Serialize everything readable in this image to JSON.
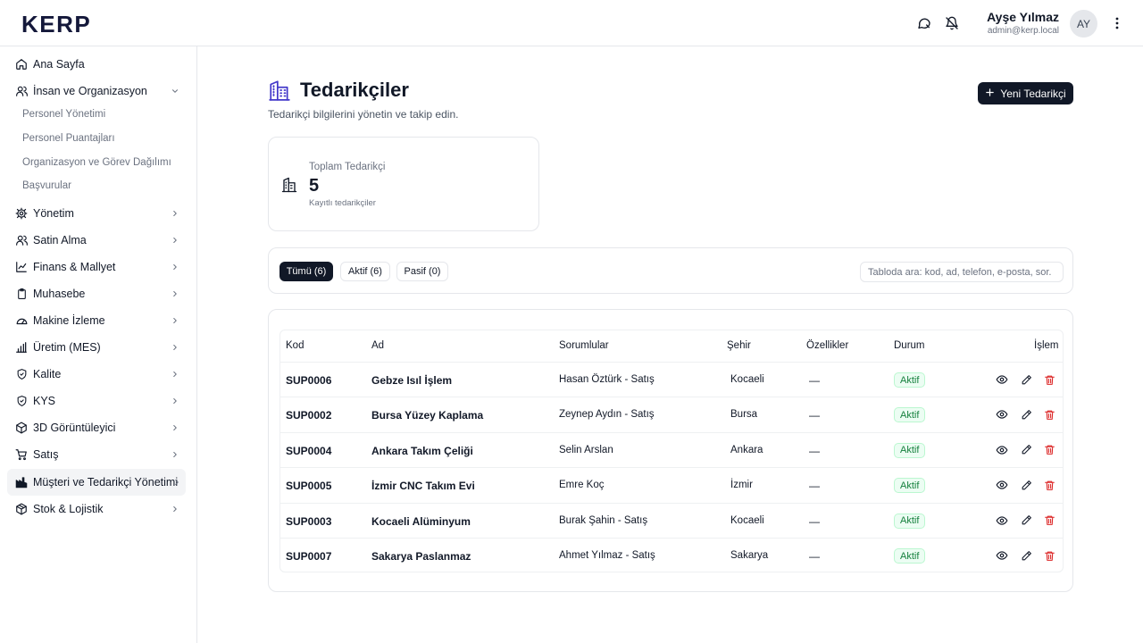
{
  "app": {
    "logo": "KERP"
  },
  "header": {
    "user_name": "Ayşe Yılmaz",
    "user_email": "admin@kerp.local",
    "avatar_initials": "AY"
  },
  "sidebar": {
    "items": [
      {
        "label": "Ana Sayfa",
        "icon": "home-icon"
      },
      {
        "label": "İnsan ve Organizasyon",
        "icon": "users-icon",
        "expanded": true
      },
      {
        "label": "Yönetim",
        "icon": "gear-icon"
      },
      {
        "label": "Satin Alma",
        "icon": "users-icon"
      },
      {
        "label": "Finans & Mallyet",
        "icon": "chart-line-icon"
      },
      {
        "label": "Muhasebe",
        "icon": "clipboard-icon"
      },
      {
        "label": "Makine İzleme",
        "icon": "gauge-icon"
      },
      {
        "label": "Üretim (MES)",
        "icon": "bar-chart-icon"
      },
      {
        "label": "Kalite",
        "icon": "shield-check-icon"
      },
      {
        "label": "KYS",
        "icon": "shield-check-icon"
      },
      {
        "label": "3D Görüntüleyici",
        "icon": "cube-icon"
      },
      {
        "label": "Satış",
        "icon": "cart-icon"
      },
      {
        "label": "Müşteri ve Tedarikçi Yönetimi",
        "icon": "factory-icon",
        "active": true
      },
      {
        "label": "Stok & Lojistik",
        "icon": "package-icon"
      }
    ],
    "sub_items": [
      "Personel Yönetimi",
      "Personel Puantajları",
      "Organizasyon ve Görev Dağılımı",
      "Başvurular"
    ]
  },
  "page": {
    "title": "Tedarikçiler",
    "subtitle": "Tedarikçi bilgilerini yönetin ve takip edin.",
    "new_button": "Yeni Tedarikçi"
  },
  "stat": {
    "label": "Toplam Tedarikçi",
    "value": "5",
    "description": "Kayıtlı tedarikçiler"
  },
  "filters": {
    "chips": [
      "Tümü (6)",
      "Aktif (6)",
      "Pasif (0)"
    ],
    "search_placeholder": "Tabloda ara: kod, ad, telefon, e-posta, sor."
  },
  "table": {
    "headers": [
      "Kod",
      "Ad",
      "Sorumlular",
      "Şehir",
      "Özellikler",
      "Durum",
      "İşlem"
    ],
    "rows": [
      {
        "code": "SUP0006",
        "name": "Gebze Isıl İşlem",
        "responsible": "Hasan Öztürk - Satış",
        "city": "Kocaeli",
        "features": "—",
        "status": "Aktif"
      },
      {
        "code": "SUP0002",
        "name": "Bursa Yüzey Kaplama",
        "responsible": "Zeynep Aydın - Satış",
        "city": "Bursa",
        "features": "—",
        "status": "Aktif"
      },
      {
        "code": "SUP0004",
        "name": "Ankara Takım Çeliği",
        "responsible": "Selin Arslan",
        "city": "Ankara",
        "features": "—",
        "status": "Aktif"
      },
      {
        "code": "SUP0005",
        "name": "İzmir CNC Takım Evi",
        "responsible": "Emre Koç",
        "city": "İzmir",
        "features": "—",
        "status": "Aktif"
      },
      {
        "code": "SUP0003",
        "name": "Kocaeli Alüminyum",
        "responsible": "Burak Şahin - Satış",
        "city": "Kocaeli",
        "features": "—",
        "status": "Aktif"
      },
      {
        "code": "SUP0007",
        "name": "Sakarya Paslanmaz",
        "responsible": "Ahmet Yılmaz - Satış",
        "city": "Sakarya",
        "features": "—",
        "status": "Aktif"
      }
    ]
  },
  "colors": {
    "primary": "#111827",
    "status_active_bg": "#ecfdf3",
    "status_active_text": "#15803d",
    "delete": "#dc2626"
  }
}
